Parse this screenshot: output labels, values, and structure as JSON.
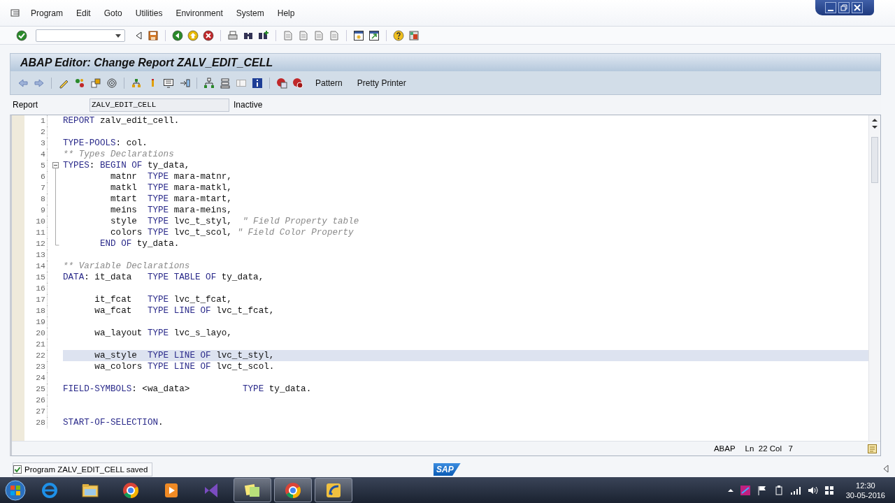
{
  "menu": [
    "Program",
    "Edit",
    "Goto",
    "Utilities",
    "Environment",
    "System",
    "Help"
  ],
  "window": {
    "title": "ABAP Editor: Change Report ZALV_EDIT_CELL"
  },
  "app_toolbar": {
    "buttons": [
      "Pattern",
      "Pretty Printer"
    ]
  },
  "report": {
    "label": "Report",
    "value": "ZALV_EDIT_CELL",
    "status": "Inactive"
  },
  "editor": {
    "lines": [
      {
        "number": "1",
        "current": false,
        "tokens": [
          {
            "kind": "keyword",
            "text": "REPORT"
          },
          {
            "kind": "plain",
            "text": " zalv_edit_cell."
          }
        ]
      },
      {
        "number": "2",
        "current": false
      },
      {
        "number": "3",
        "current": false,
        "tokens": [
          {
            "kind": "keyword",
            "text": "TYPE-POOLS"
          },
          {
            "kind": "plain",
            "text": ": col."
          }
        ]
      },
      {
        "number": "4",
        "current": false,
        "tokens": [
          {
            "kind": "comment",
            "text": "** Types Declarations"
          }
        ]
      },
      {
        "number": "5",
        "current": false,
        "expanded": true,
        "tokens": [
          {
            "kind": "keyword",
            "text": "TYPES"
          },
          {
            "kind": "plain",
            "text": ": "
          },
          {
            "kind": "keyword",
            "text": "BEGIN OF"
          },
          {
            "kind": "plain",
            "text": " ty_data,"
          }
        ],
        "children": [
          {
            "number": "6",
            "current": false,
            "tokens": [
              {
                "kind": "plain",
                "text": "         matnr  "
              },
              {
                "kind": "keyword",
                "text": "TYPE"
              },
              {
                "kind": "plain",
                "text": " mara-matnr,"
              }
            ]
          },
          {
            "number": "7",
            "current": false,
            "tokens": [
              {
                "kind": "plain",
                "text": "         matkl  "
              },
              {
                "kind": "keyword",
                "text": "TYPE"
              },
              {
                "kind": "plain",
                "text": " mara-matkl,"
              }
            ]
          },
          {
            "number": "8",
            "current": false,
            "tokens": [
              {
                "kind": "plain",
                "text": "         mtart  "
              },
              {
                "kind": "keyword",
                "text": "TYPE"
              },
              {
                "kind": "plain",
                "text": " mara-mtart,"
              }
            ]
          },
          {
            "number": "9",
            "current": false,
            "tokens": [
              {
                "kind": "plain",
                "text": "         meins  "
              },
              {
                "kind": "keyword",
                "text": "TYPE"
              },
              {
                "kind": "plain",
                "text": " mara-meins,"
              }
            ]
          },
          {
            "number": "10",
            "current": false,
            "tokens": [
              {
                "kind": "plain",
                "text": "         style  "
              },
              {
                "kind": "keyword",
                "text": "TYPE"
              },
              {
                "kind": "plain",
                "text": " lvc_t_styl,  "
              },
              {
                "kind": "comment",
                "text": "\" Field Property table"
              }
            ]
          },
          {
            "number": "11",
            "current": false,
            "tokens": [
              {
                "kind": "plain",
                "text": "         colors "
              },
              {
                "kind": "keyword",
                "text": "TYPE"
              },
              {
                "kind": "plain",
                "text": " lvc_t_scol, "
              },
              {
                "kind": "comment",
                "text": "\" Field Color Property"
              }
            ]
          },
          {
            "number": "12",
            "current": false,
            "tokens": [
              {
                "kind": "keyword",
                "text": "       END OF"
              },
              {
                "kind": "plain",
                "text": " ty_data."
              }
            ]
          }
        ]
      },
      {
        "number": "13",
        "current": false
      },
      {
        "number": "14",
        "current": false,
        "tokens": [
          {
            "kind": "comment",
            "text": "** Variable Declarations"
          }
        ]
      },
      {
        "number": "15",
        "current": false,
        "tokens": [
          {
            "kind": "keyword",
            "text": "DATA"
          },
          {
            "kind": "plain",
            "text": ": it_data   "
          },
          {
            "kind": "keyword",
            "text": "TYPE TABLE OF"
          },
          {
            "kind": "plain",
            "text": " ty_data,"
          }
        ]
      },
      {
        "number": "16",
        "current": false
      },
      {
        "number": "17",
        "current": false,
        "tokens": [
          {
            "kind": "plain",
            "text": "      it_fcat   "
          },
          {
            "kind": "keyword",
            "text": "TYPE"
          },
          {
            "kind": "plain",
            "text": " lvc_t_fcat,"
          }
        ]
      },
      {
        "number": "18",
        "current": false,
        "tokens": [
          {
            "kind": "plain",
            "text": "      wa_fcat   "
          },
          {
            "kind": "keyword",
            "text": "TYPE LINE OF"
          },
          {
            "kind": "plain",
            "text": " lvc_t_fcat,"
          }
        ]
      },
      {
        "number": "19",
        "current": false
      },
      {
        "number": "20",
        "current": false,
        "tokens": [
          {
            "kind": "plain",
            "text": "      wa_layout "
          },
          {
            "kind": "keyword",
            "text": "TYPE"
          },
          {
            "kind": "plain",
            "text": " lvc_s_layo,"
          }
        ]
      },
      {
        "number": "21",
        "current": false
      },
      {
        "number": "22",
        "current": true,
        "tokens": [
          {
            "kind": "plain",
            "text": "      wa_style  "
          },
          {
            "kind": "keyword",
            "text": "TYPE LINE OF"
          },
          {
            "kind": "plain",
            "text": " lvc_t_styl,"
          }
        ]
      },
      {
        "number": "23",
        "current": false,
        "tokens": [
          {
            "kind": "plain",
            "text": "      wa_colors "
          },
          {
            "kind": "keyword",
            "text": "TYPE LINE OF"
          },
          {
            "kind": "plain",
            "text": " lvc_t_scol."
          }
        ]
      },
      {
        "number": "24",
        "current": false
      },
      {
        "number": "25",
        "current": false,
        "tokens": [
          {
            "kind": "keyword",
            "text": "FIELD-SYMBOLS"
          },
          {
            "kind": "plain",
            "text": ": <wa_data>          "
          },
          {
            "kind": "keyword",
            "text": "TYPE"
          },
          {
            "kind": "plain",
            "text": " ty_data."
          }
        ]
      },
      {
        "number": "26",
        "current": false
      },
      {
        "number": "27",
        "current": false
      },
      {
        "number": "28",
        "current": false,
        "tokens": [
          {
            "kind": "keyword",
            "text": "START-OF-SELECTION"
          },
          {
            "kind": "plain",
            "text": "."
          }
        ]
      }
    ],
    "language": "ABAP",
    "position": "Ln  22 Col   7"
  },
  "status_bar": {
    "message": "Program ZALV_EDIT_CELL saved",
    "kind": "success",
    "logo": "SAP"
  },
  "taskbar": {
    "apps": [
      {
        "kind": "ie",
        "open": false
      },
      {
        "kind": "folder",
        "open": false
      },
      {
        "kind": "chrome",
        "open": false
      },
      {
        "kind": "media",
        "open": false
      },
      {
        "kind": "vstudio",
        "open": false
      },
      {
        "kind": "notes",
        "open": true
      },
      {
        "kind": "chrome",
        "open": true
      },
      {
        "kind": "sap",
        "open": true
      }
    ],
    "time": "12:30",
    "date": "30-05-2016"
  }
}
